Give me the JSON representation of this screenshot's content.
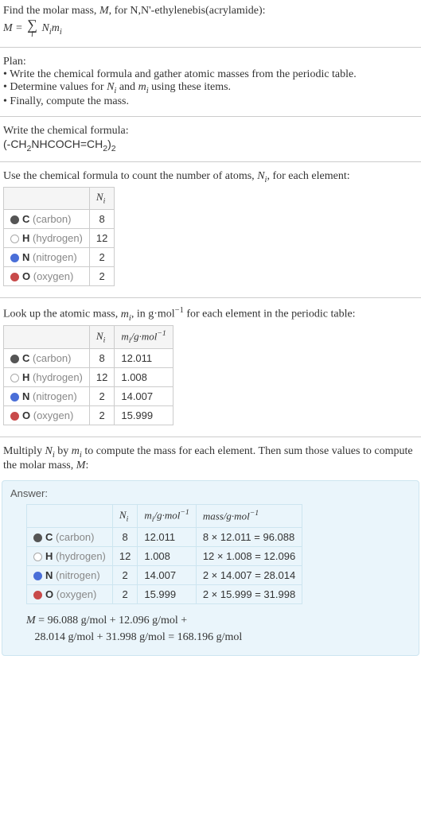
{
  "intro": {
    "line1": "Find the molar mass, ",
    "var_M": "M",
    "line1_end": ", for N,N'-ethylenebis(acrylamide):",
    "eq_left": "M = ",
    "eq_sum_sub": "i",
    "eq_right_N": "N",
    "eq_right_m": "m"
  },
  "plan": {
    "title": "Plan:",
    "b1_a": "• Write the chemical formula and gather atomic masses from the periodic table.",
    "b2_a": "• Determine values for ",
    "b2_b": " and ",
    "b2_c": " using these items.",
    "b3": "• Finally, compute the mass."
  },
  "write_formula": {
    "title": "Write the chemical formula:",
    "formula_a": "(-CH",
    "formula_b": "NHCOCH=CH",
    "formula_c": ")",
    "sub2": "2"
  },
  "count_atoms": {
    "title_a": "Use the chemical formula to count the number of atoms, ",
    "title_b": ", for each element:"
  },
  "elements": [
    {
      "dot": "c",
      "sym": "C",
      "name": "(carbon)",
      "N": "8",
      "m": "12.011",
      "mass": "8 × 12.011 = 96.088",
      "mass2": "12 × 1.008 = 12.096"
    },
    {
      "dot": "h",
      "sym": "H",
      "name": "(hydrogen)",
      "N": "12",
      "m": "1.008",
      "mass": "12 × 1.008 = 12.096"
    },
    {
      "dot": "n",
      "sym": "N",
      "name": "(nitrogen)",
      "N": "2",
      "m": "14.007",
      "mass": "2 × 14.007 = 28.014"
    },
    {
      "dot": "o",
      "sym": "O",
      "name": "(oxygen)",
      "N": "2",
      "m": "15.999",
      "mass": "2 × 15.999 = 31.998"
    }
  ],
  "headers": {
    "Ni": "N",
    "Ni_sub": "i",
    "mi": "m",
    "mi_sub": "i",
    "mi_unit": "/g·mol",
    "neg1": "−1",
    "mass": "mass/g·mol"
  },
  "lookup": {
    "title_a": "Look up the atomic mass, ",
    "title_b": ", in g·mol",
    "title_c": " for each element in the periodic table:"
  },
  "multiply": {
    "text_a": "Multiply ",
    "text_b": " by ",
    "text_c": " to compute the mass for each element. Then sum those values to compute the molar mass, ",
    "text_d": ":"
  },
  "answer": {
    "title": "Answer:",
    "final_a": "M",
    "final_b": " = 96.088 g/mol + 12.096 g/mol + ",
    "final_c": "28.014 g/mol + 31.998 g/mol = 168.196 g/mol"
  }
}
